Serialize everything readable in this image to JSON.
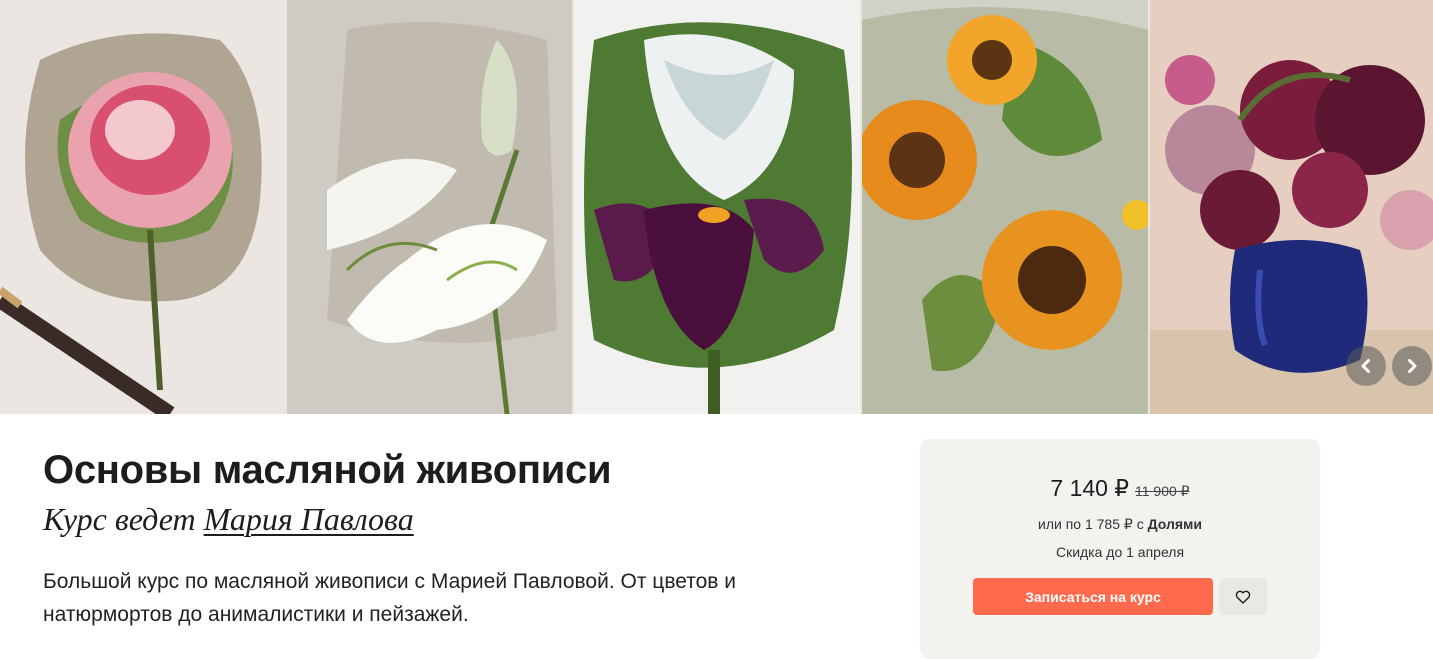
{
  "gallery": {
    "images": [
      {
        "name": "peony-painting",
        "bg": "#ece6e2"
      },
      {
        "name": "lily-painting",
        "bg": "#cfcbc4"
      },
      {
        "name": "iris-painting",
        "bg": "#f1f1ef"
      },
      {
        "name": "sunflowers-painting",
        "bg": "#cfd2c7"
      },
      {
        "name": "dahlias-painting",
        "bg": "#e6cfc0"
      }
    ],
    "prev_icon": "chevron-left-icon",
    "next_icon": "chevron-right-icon"
  },
  "course": {
    "title": "Основы масляной живописи",
    "author_prefix": "Курс ведет ",
    "author_name": "Мария Павлова",
    "description": "Большой курс по масляной живописи с Марией Павловой. От цветов и натюрмортов до анималистики и пейзажей."
  },
  "pricing": {
    "current_price": "7 140 ₽",
    "old_price": "11 900 ₽",
    "installment_prefix": "или по 1 785 ₽ с ",
    "installment_provider": "Долями",
    "discount_note": "Скидка до 1 апреля",
    "enroll_label": "Записаться на курс",
    "favorite_icon": "heart-icon"
  },
  "colors": {
    "accent": "#ff6a4c",
    "card_bg": "#f3f2ef"
  }
}
